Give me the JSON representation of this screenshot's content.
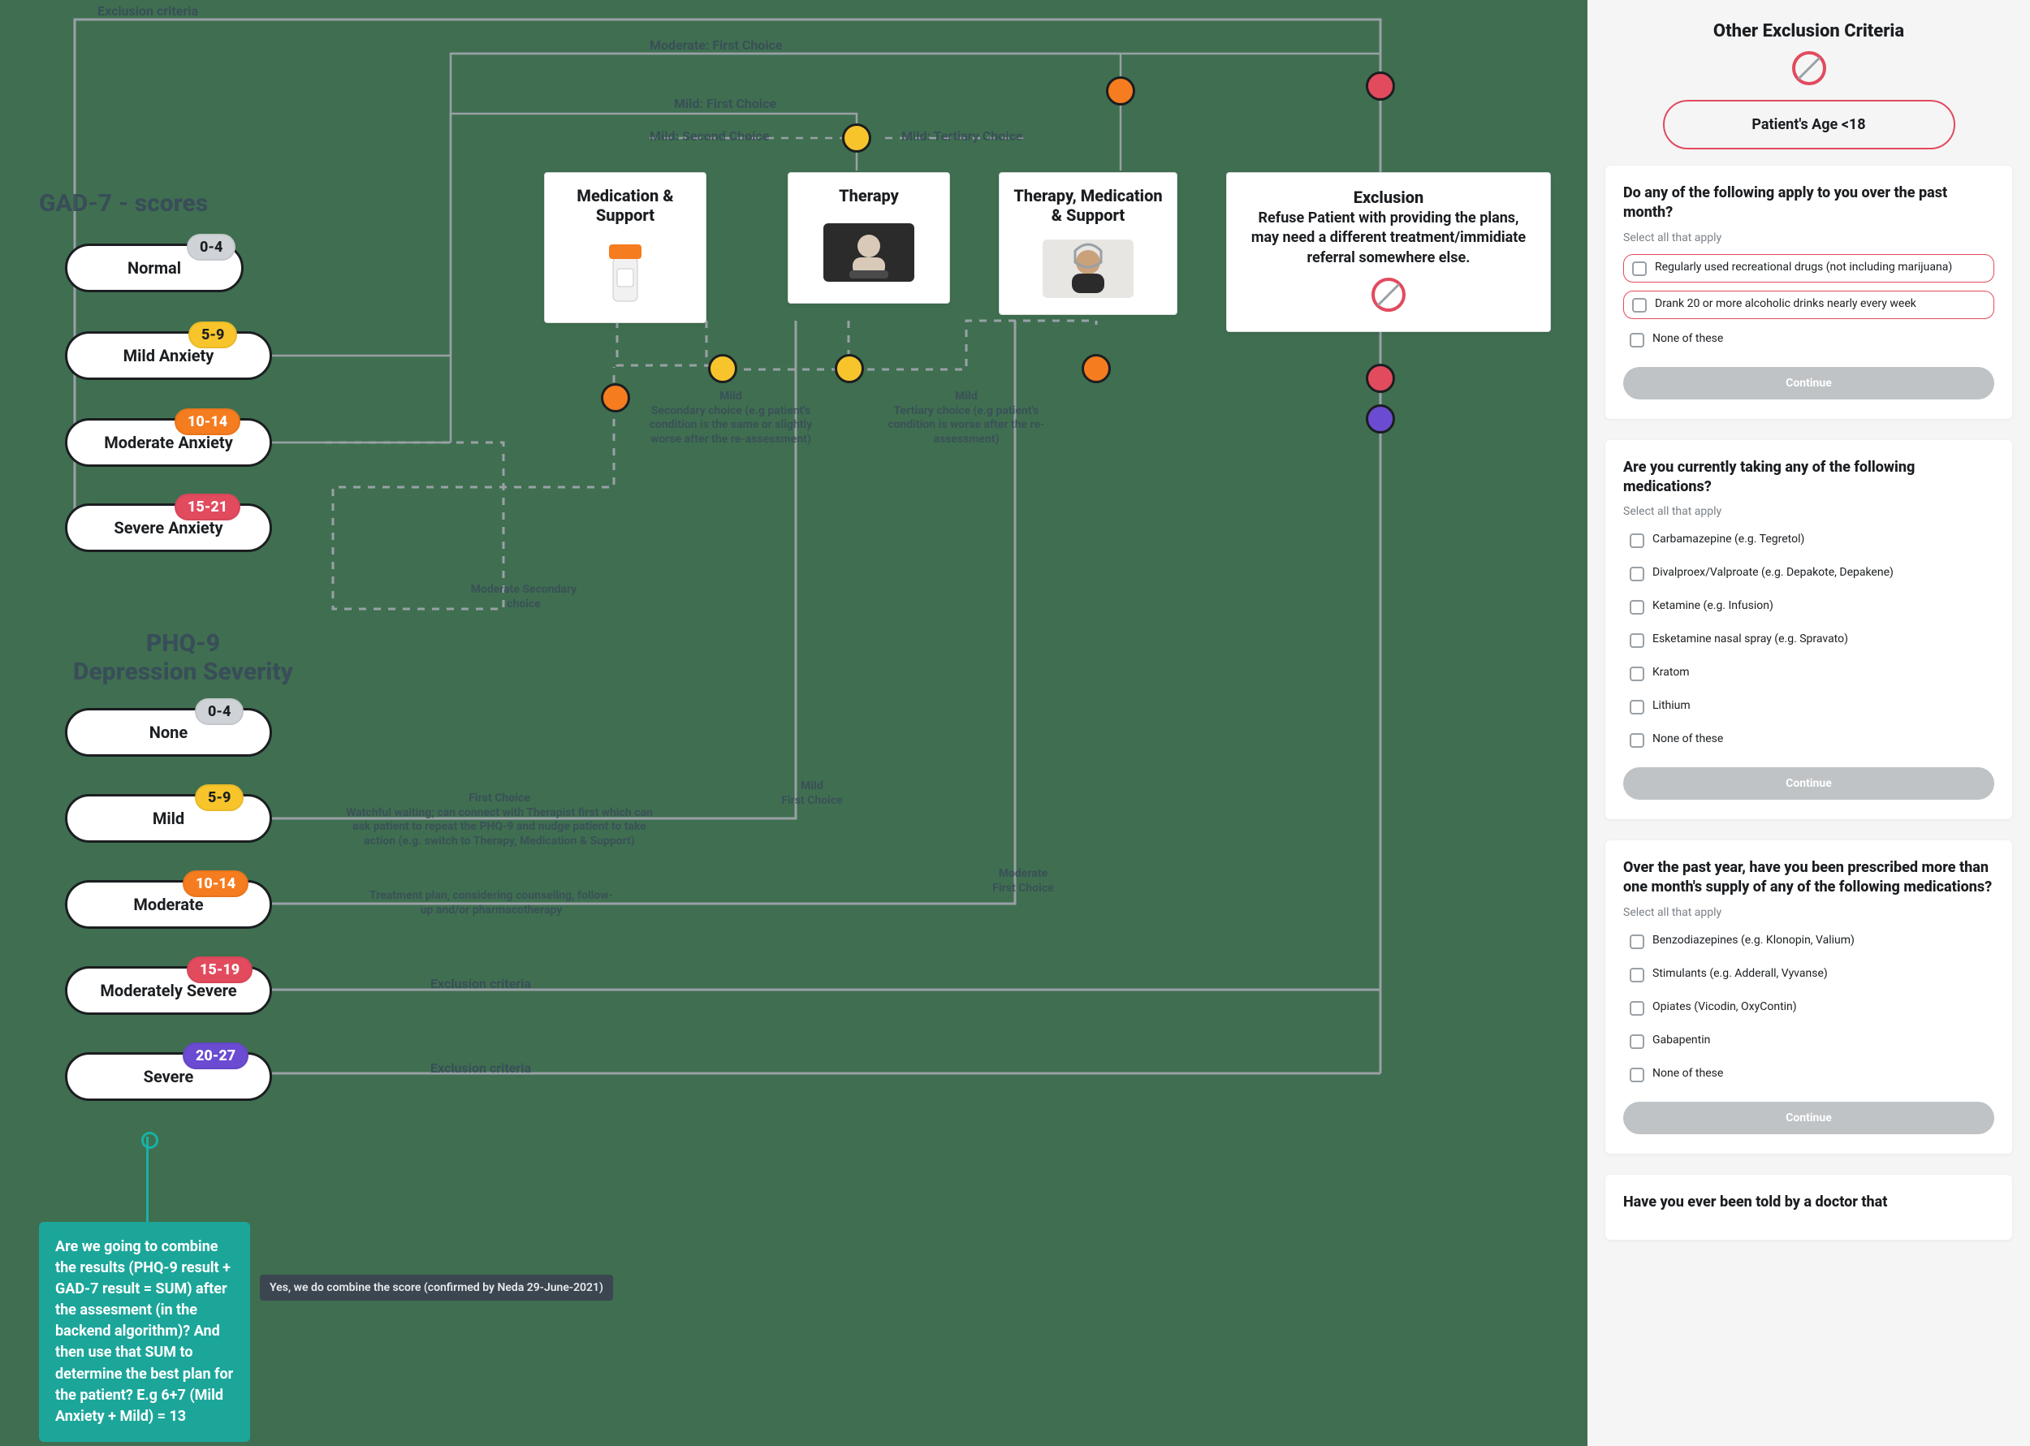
{
  "diagram": {
    "gad7": {
      "title": "GAD-7 - scores",
      "items": [
        {
          "label": "Normal",
          "range": "0-4",
          "color": "gray"
        },
        {
          "label": "Mild Anxiety",
          "range": "5-9",
          "color": "yellow"
        },
        {
          "label": "Moderate Anxiety",
          "range": "10-14",
          "color": "orange"
        },
        {
          "label": "Severe Anxiety",
          "range": "15-21",
          "color": "red"
        }
      ]
    },
    "phq9": {
      "title_line1": "PHQ-9",
      "title_line2": "Depression Severity",
      "items": [
        {
          "label": "None",
          "range": "0-4",
          "color": "gray"
        },
        {
          "label": "Mild",
          "range": "5-9",
          "color": "yellow"
        },
        {
          "label": "Moderate",
          "range": "10-14",
          "color": "orange"
        },
        {
          "label": "Moderately Severe",
          "range": "15-19",
          "color": "red"
        },
        {
          "label": "Severe",
          "range": "20-27",
          "color": "purple"
        }
      ]
    },
    "cards": {
      "medication": {
        "title_line1": "Medication &",
        "title_line2": "Support"
      },
      "therapy": {
        "title": "Therapy"
      },
      "both": {
        "title_line1": "Therapy, Medication",
        "title_line2": "& Support"
      },
      "exclusion": {
        "title": "Exclusion",
        "desc": "Refuse Patient with providing the plans, may need a different treatment/immidiate referral somewhere else."
      }
    },
    "edge_labels": {
      "exclusion_top": "Exclusion criteria",
      "moderate_first": "Moderate: First Choice",
      "mild_first": "Mild: First Choice",
      "mild_second": "Mild: Second Choice",
      "mild_tertiary": "Mild: Tertiary Choice",
      "mild_secondary_note_title": "Mild",
      "mild_secondary_note": "Secondary choice (e.g patient's condition is the same or slightly worse after the re-assessment)",
      "mild_tertiary_note_title": "Mild",
      "mild_tertiary_note": "Tertiary choice (e.g patient's condition is worse after the re-assessment)",
      "moderate_secondary": "Moderate Secondary choice",
      "phq_mild_first_title": "Mild",
      "phq_mild_first": "First Choice",
      "phq_moderate_first_title": "Moderate",
      "phq_moderate_first": "First Choice",
      "phq_mild_plan_title": "First Choice",
      "phq_mild_plan": "Watchful waiting; can connect with Therapist first which can ask patient to repeat the PHQ-9 and nudge patient to take action (e.g. switch to Therapy, Medication & Support)",
      "phq_moderate_plan": "Treatment plan, considering counseling, follow-up and/or pharmacotherapy",
      "exclusion_row1": "Exclusion criteria",
      "exclusion_row2": "Exclusion criteria"
    },
    "comment": {
      "note": "Are we going to combine the results (PHQ-9 result + GAD-7 result = SUM) after the assesment (in the backend algorithm)? And then use that SUM to determine the best plan for the patient? E.g 6+7 (Mild Anxiety + Mild)  = 13",
      "reply": "Yes, we do combine the score (confirmed by Neda 29-June-2021)"
    }
  },
  "form": {
    "title": "Other Exclusion Criteria",
    "age_pill": "Patient's Age <18",
    "hint": "Select all that apply",
    "continue": "Continue",
    "q1": {
      "question": "Do any of the following apply to you over the past month?",
      "options": [
        {
          "label": "Regularly used recreational drugs (not including marijuana)",
          "outlined": true
        },
        {
          "label": "Drank 20 or more alcoholic drinks nearly every week",
          "outlined": true
        },
        {
          "label": "None of these",
          "outlined": false
        }
      ]
    },
    "q2": {
      "question": "Are you currently taking any of the following medications?",
      "options": [
        {
          "label": "Carbamazepine (e.g. Tegretol)"
        },
        {
          "label": "Divalproex/Valproate (e.g. Depakote, Depakene)"
        },
        {
          "label": "Ketamine (e.g. Infusion)"
        },
        {
          "label": "Esketamine nasal spray (e.g. Spravato)"
        },
        {
          "label": "Kratom"
        },
        {
          "label": "Lithium"
        },
        {
          "label": "None of these"
        }
      ]
    },
    "q3": {
      "question": "Over the past year, have you been prescribed more than one month's supply of any of the following medications?",
      "options": [
        {
          "label": "Benzodiazepines (e.g. Klonopin, Valium)"
        },
        {
          "label": "Stimulants (e.g. Adderall, Vyvanse)"
        },
        {
          "label": "Opiates (Vicodin, OxyContin)"
        },
        {
          "label": "Gabapentin"
        },
        {
          "label": "None of these"
        }
      ]
    },
    "q4": {
      "question": "Have you ever been told by a doctor that"
    }
  }
}
